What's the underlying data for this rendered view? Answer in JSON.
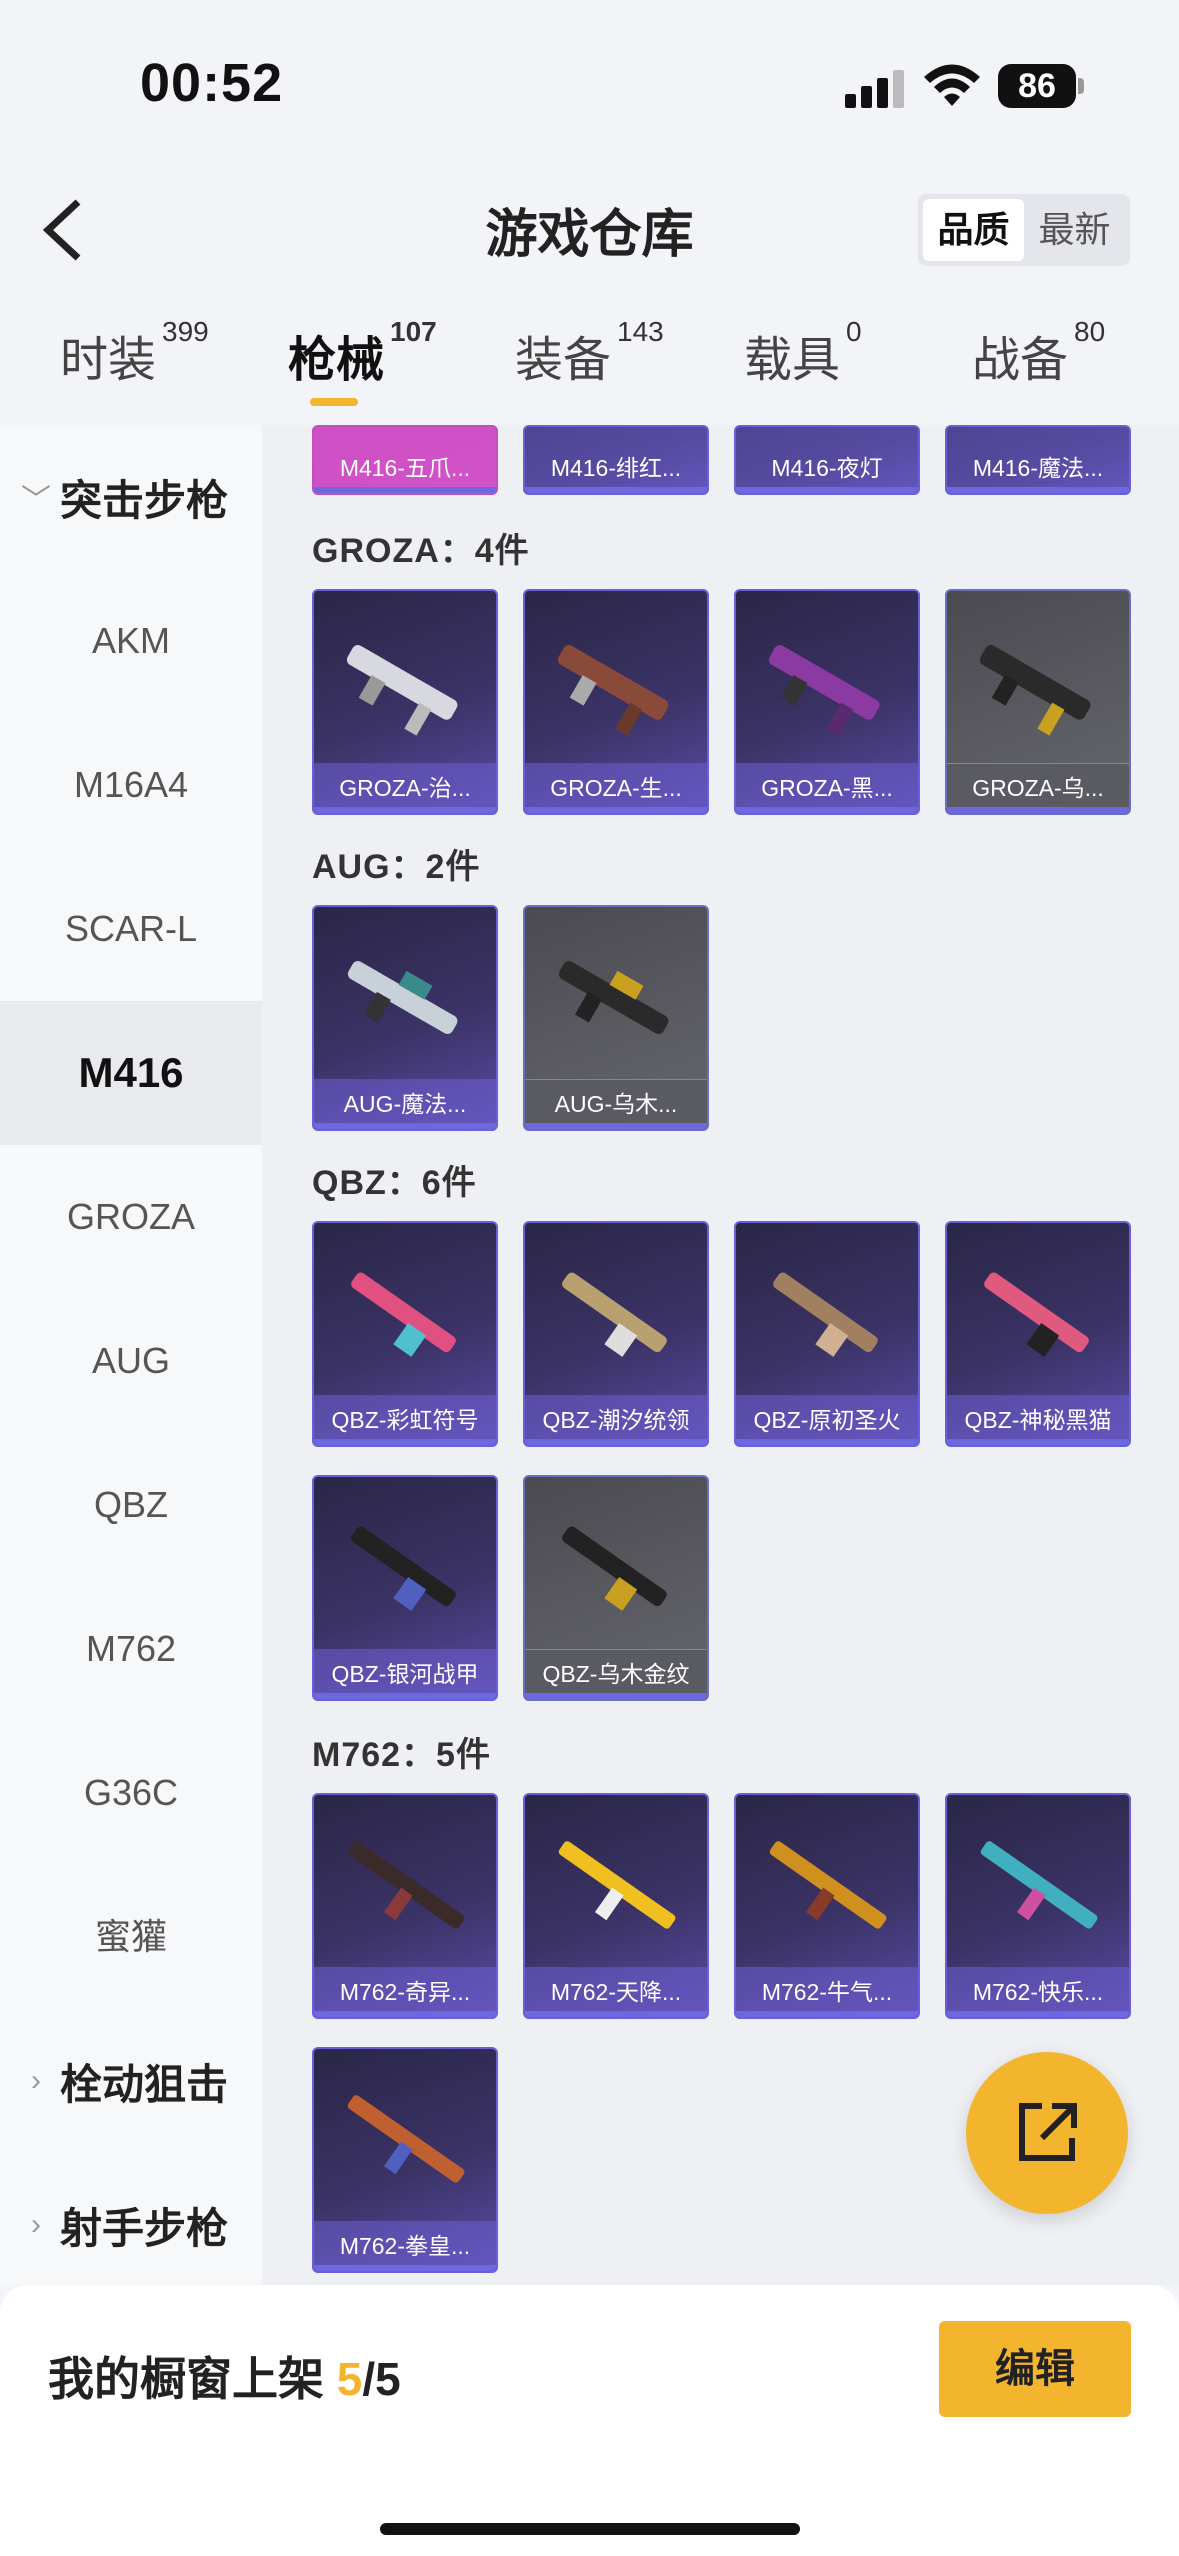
{
  "status": {
    "time": "00:52",
    "battery": "86"
  },
  "header": {
    "title": "游戏仓库",
    "sort_quality": "品质",
    "sort_newest": "最新"
  },
  "tabs": [
    {
      "label": "时装",
      "count": "399"
    },
    {
      "label": "枪械",
      "count": "107"
    },
    {
      "label": "装备",
      "count": "143"
    },
    {
      "label": "载具",
      "count": "0"
    },
    {
      "label": "战备",
      "count": "80"
    }
  ],
  "sidebar": {
    "group_assault": "突击步枪",
    "items": [
      "AKM",
      "M16A4",
      "SCAR-L",
      "M416",
      "GROZA",
      "AUG",
      "QBZ",
      "M762",
      "G36C",
      "蜜獾"
    ],
    "group_bolt": "栓动狙击",
    "group_marksman": "射手步枪"
  },
  "sections": {
    "m416_partial": [
      "M416-五爪...",
      "M416-绯红...",
      "M416-夜灯",
      "M416-魔法..."
    ],
    "groza": {
      "label": "GROZA：4件",
      "items": [
        "GROZA-治...",
        "GROZA-生...",
        "GROZA-黑...",
        "GROZA-乌..."
      ]
    },
    "aug": {
      "label": "AUG：2件",
      "items": [
        "AUG-魔法...",
        "AUG-乌木..."
      ]
    },
    "qbz": {
      "label": "QBZ：6件",
      "items": [
        "QBZ-彩虹符号",
        "QBZ-潮汐统领",
        "QBZ-原初圣火",
        "QBZ-神秘黑猫",
        "QBZ-银河战甲",
        "QBZ-乌木金纹"
      ]
    },
    "m762": {
      "label": "M762：5件",
      "items": [
        "M762-奇异...",
        "M762-天降...",
        "M762-牛气...",
        "M762-快乐...",
        "M762-拳皇..."
      ]
    }
  },
  "bottom": {
    "showcase_prefix": "我的橱窗上架 ",
    "showcase_count": "5",
    "showcase_total": "/5",
    "edit_label": "编辑"
  },
  "colors": {
    "accent": "#f3b52e",
    "card_purple": "#3b3366",
    "card_border": "#6a5fd6"
  }
}
